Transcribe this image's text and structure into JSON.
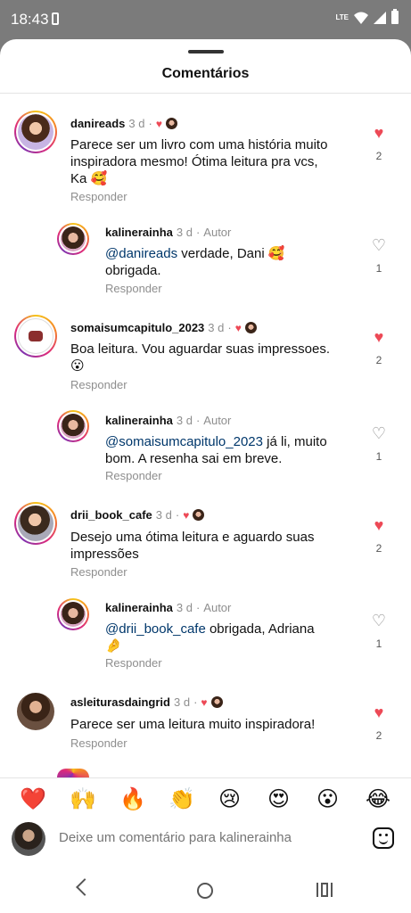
{
  "status": {
    "time": "18:43",
    "network": "LTE"
  },
  "sheet": {
    "title": "Comentários"
  },
  "comments": [
    {
      "user": "danireads",
      "time": "3 d",
      "text": "Parece ser um livro com uma história muito inspiradora mesmo! Ótima leitura pra vcs, Ka 🥰",
      "reply_label": "Responder",
      "likes": "2",
      "liked": true
    },
    {
      "user": "kalinerainha",
      "time": "3 d",
      "author_label": "Autor",
      "mention": "@danireads",
      "text": " verdade, Dani 🥰 obrigada.",
      "reply_label": "Responder",
      "likes": "1",
      "liked": false
    },
    {
      "user": "somaisumcapitulo_2023",
      "time": "3 d",
      "text": "Boa leitura. Vou aguardar suas impressoes. 😮",
      "reply_label": "Responder",
      "likes": "2",
      "liked": true
    },
    {
      "user": "kalinerainha",
      "time": "3 d",
      "author_label": "Autor",
      "mention": "@somaisumcapitulo_2023",
      "text": " já li, muito bom. A resenha sai em breve.",
      "reply_label": "Responder",
      "likes": "1",
      "liked": false
    },
    {
      "user": "drii_book_cafe",
      "time": "3 d",
      "text": "Desejo uma ótima leitura e aguardo suas impressões",
      "reply_label": "Responder",
      "likes": "2",
      "liked": true
    },
    {
      "user": "kalinerainha",
      "time": "3 d",
      "author_label": "Autor",
      "mention": "@drii_book_cafe",
      "text": " obrigada, Adriana 🤌",
      "reply_label": "Responder",
      "likes": "1",
      "liked": false
    },
    {
      "user": "asleiturasdaingrid",
      "time": "3 d",
      "text": "Parece ser uma leitura muito inspiradora!",
      "reply_label": "Responder",
      "likes": "2",
      "liked": true
    }
  ],
  "emoji_bar": [
    "❤️",
    "🙌",
    "🔥",
    "👏",
    "😢",
    "😍",
    "😮",
    "😂"
  ],
  "composer": {
    "placeholder": "Deixe um comentário para kalinerainha"
  },
  "separator": "·",
  "colors": {
    "like": "#ed4956",
    "mention": "#00376b",
    "muted": "#8e8e8e"
  }
}
